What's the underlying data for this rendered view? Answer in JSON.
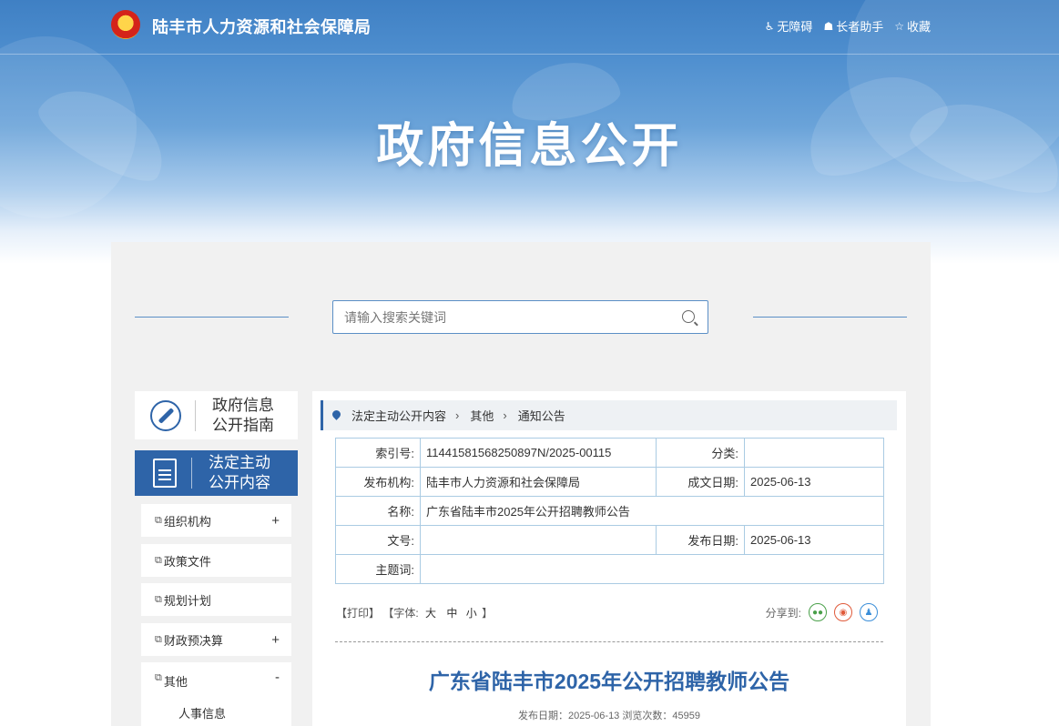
{
  "header": {
    "site_title": "陆丰市人力资源和社会保障局",
    "links": [
      {
        "icon": "wheelchair-icon",
        "label": "无障碍"
      },
      {
        "icon": "elder-assist-icon",
        "label": "长者助手"
      },
      {
        "icon": "star-icon",
        "label": "收藏"
      }
    ],
    "hero_title": "政府信息公开"
  },
  "search": {
    "placeholder": "请输入搜索关键词"
  },
  "sidebar": {
    "guide_label_1": "政府信息",
    "guide_label_2": "公开指南",
    "active_label_1": "法定主动",
    "active_label_2": "公开内容",
    "items": [
      {
        "label": "组织机构",
        "toggle": "+"
      },
      {
        "label": "政策文件",
        "toggle": ""
      },
      {
        "label": "规划计划",
        "toggle": ""
      },
      {
        "label": "财政预决算",
        "toggle": "+"
      },
      {
        "label": "其他",
        "toggle": "-"
      }
    ],
    "sub_items": [
      "人事信息"
    ]
  },
  "breadcrumb": [
    "法定主动公开内容",
    "其他",
    "通知公告"
  ],
  "meta": {
    "index_label": "索引号:",
    "index_value": "11441581568250897N/2025-00115",
    "category_label": "分类:",
    "category_value": "",
    "publisher_label": "发布机构:",
    "publisher_value": "陆丰市人力资源和社会保障局",
    "created_label": "成文日期:",
    "created_value": "2025-06-13",
    "name_label": "名称:",
    "name_value": "广东省陆丰市2025年公开招聘教师公告",
    "docno_label": "文号:",
    "docno_value": "",
    "published_label": "发布日期:",
    "published_value": "2025-06-13",
    "keywords_label": "主题词:",
    "keywords_value": ""
  },
  "tools": {
    "print": "【打印】",
    "font_prefix": "【字体:",
    "font_large": "大",
    "font_medium": "中",
    "font_small": "小",
    "font_suffix": "】",
    "share_label": "分享到:"
  },
  "article": {
    "title": "广东省陆丰市2025年公开招聘教师公告",
    "meta_line": "发布日期：2025-06-13  浏览次数：45959"
  },
  "colors": {
    "accent": "#2e64a8",
    "table_border": "#aacbe3",
    "panel_bg": "#f1f1f1"
  }
}
